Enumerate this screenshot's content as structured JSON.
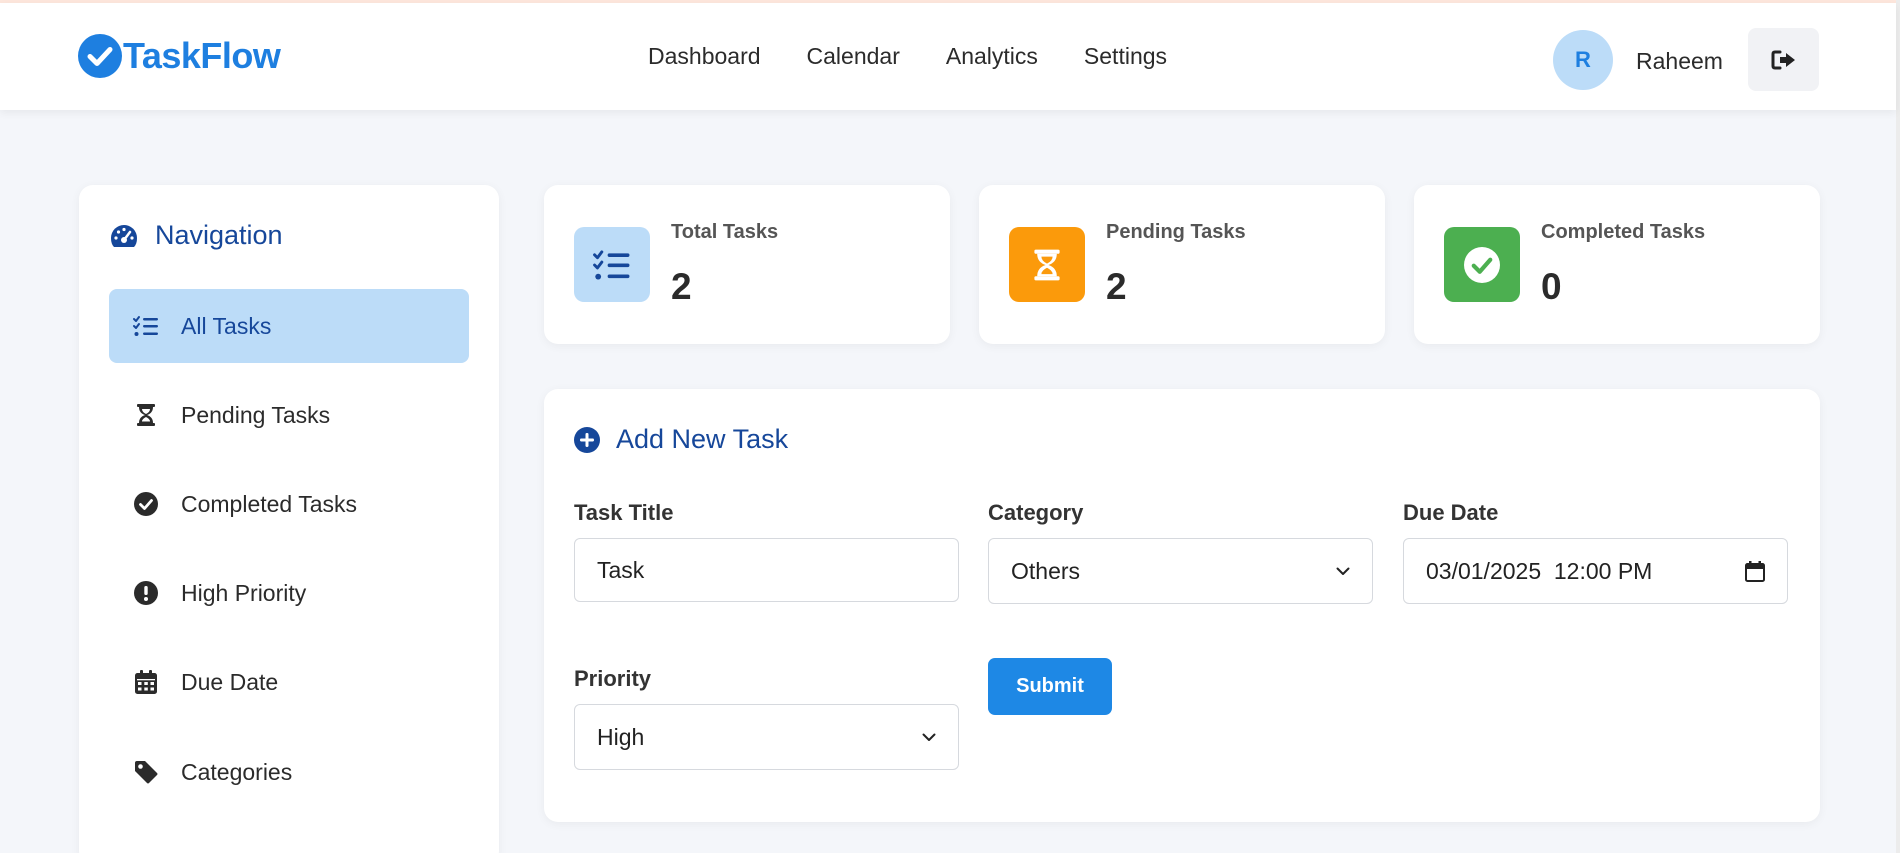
{
  "app": {
    "name": "TaskFlow"
  },
  "nav": [
    "Dashboard",
    "Calendar",
    "Analytics",
    "Settings"
  ],
  "user": {
    "initial": "R",
    "name": "Raheem"
  },
  "sidebar": {
    "title": "Navigation",
    "items": [
      {
        "label": "All Tasks",
        "icon": "list-check-icon",
        "active": true
      },
      {
        "label": "Pending Tasks",
        "icon": "hourglass-icon"
      },
      {
        "label": "Completed Tasks",
        "icon": "check-circle-icon"
      },
      {
        "label": "High Priority",
        "icon": "exclamation-circle-icon"
      },
      {
        "label": "Due Date",
        "icon": "calendar-icon"
      },
      {
        "label": "Categories",
        "icon": "tag-icon"
      }
    ]
  },
  "stats": [
    {
      "label": "Total Tasks",
      "value": "2",
      "icon": "list-check-icon",
      "color": "#bcdcf8"
    },
    {
      "label": "Pending Tasks",
      "value": "2",
      "icon": "hourglass-icon",
      "color": "#fb9a0b"
    },
    {
      "label": "Completed Tasks",
      "value": "0",
      "icon": "check-circle-icon",
      "color": "#4caf50"
    }
  ],
  "form": {
    "title": "Add New Task",
    "task_title": {
      "label": "Task Title",
      "value": "Task"
    },
    "category": {
      "label": "Category",
      "value": "Others"
    },
    "due_date": {
      "label": "Due Date",
      "value": "03/01/2025  12:00 PM"
    },
    "priority": {
      "label": "Priority",
      "value": "High"
    },
    "submit_label": "Submit"
  },
  "colors": {
    "brand": "#1e7fe0",
    "heading": "#16479a",
    "active_bg": "#bcdcf8",
    "button": "#1e88e5"
  }
}
